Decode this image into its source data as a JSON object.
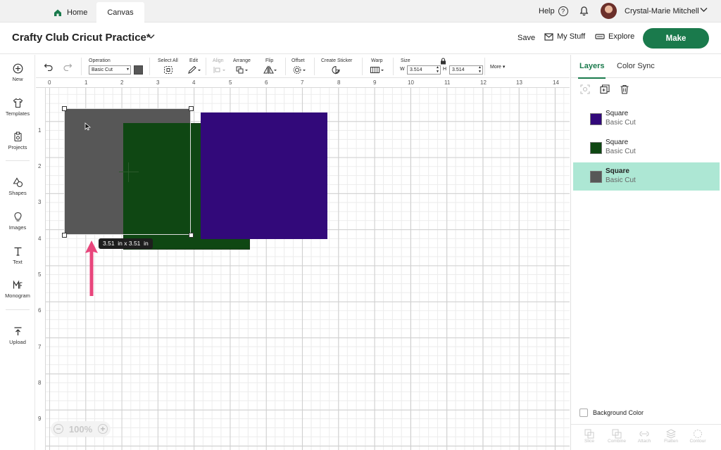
{
  "tabs": {
    "home": "Home",
    "canvas": "Canvas"
  },
  "user": {
    "help": "Help",
    "help_glyph": "?",
    "name": "Crystal-Marie Mitchell"
  },
  "header": {
    "title": "Crafty Club Cricut Practice*",
    "save": "Save",
    "my_stuff": "My Stuff",
    "explore": "Explore",
    "make": "Make"
  },
  "sidebar": {
    "items": [
      "New",
      "Templates",
      "Projects",
      "Shapes",
      "Images",
      "Text",
      "Monogram",
      "Upload"
    ]
  },
  "toolbar": {
    "operation": "Operation",
    "operation_value": "Basic Cut",
    "select_all": "Select All",
    "edit": "Edit",
    "align": "Align",
    "arrange": "Arrange",
    "flip": "Flip",
    "offset": "Offset",
    "create_sticker": "Create Sticker",
    "warp": "Warp",
    "size": "Size",
    "w_label": "W",
    "w_value": "3.514",
    "h_label": "H",
    "h_value": "3.514",
    "more": "More"
  },
  "canvas": {
    "ruler_x": [
      "0",
      "1",
      "2",
      "3",
      "4",
      "5",
      "6",
      "7",
      "8",
      "9",
      "10",
      "11",
      "12",
      "13",
      "14"
    ],
    "ruler_y": [
      "1",
      "2",
      "3",
      "4",
      "5",
      "6",
      "7",
      "8",
      "9"
    ],
    "dimension_tooltip": "3.51  in x 3.51  in",
    "zoom": "100%",
    "zoom_minus": "−",
    "zoom_plus": "+"
  },
  "shape_colors": {
    "gray": "#575757",
    "green": "#0f4713",
    "purple": "#32097a"
  },
  "accent": "#1a7a4c",
  "arrow_color": "#e8467c",
  "panel": {
    "tab_layers": "Layers",
    "tab_color_sync": "Color Sync",
    "layers": [
      {
        "name": "Square",
        "sub": "Basic Cut",
        "color": "#32097a"
      },
      {
        "name": "Square",
        "sub": "Basic Cut",
        "color": "#0f4713"
      },
      {
        "name": "Square",
        "sub": "Basic Cut",
        "color": "#575757"
      }
    ],
    "background_color": "Background Color",
    "footer": [
      "Slice",
      "Combine",
      "Attach",
      "Flatten",
      "Contour"
    ]
  }
}
